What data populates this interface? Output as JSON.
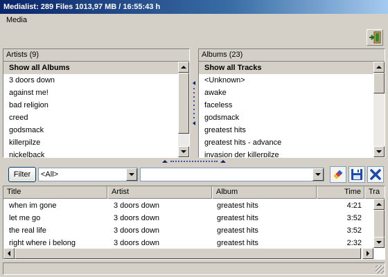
{
  "window": {
    "title": "Medialist: 289 Files 1013,97 MB / 16:55:43 h"
  },
  "menu": {
    "items": [
      "Media"
    ]
  },
  "artists": {
    "header": "Artists (9)",
    "items": [
      "Show all Albums",
      "3 doors down",
      "against me!",
      "bad religion",
      "creed",
      "godsmack",
      "killerpilze",
      "nickelback"
    ]
  },
  "albums": {
    "header": "Albums (23)",
    "items": [
      "Show all Tracks",
      "<Unknown>",
      "awake",
      "faceless",
      "godsmack",
      "greatest hits",
      "greatest hits - advance",
      "invasion der killerpilze"
    ]
  },
  "filter": {
    "button_label": "Filter",
    "field_value": "<All>",
    "search_value": ""
  },
  "tracks": {
    "columns": [
      "Title",
      "Artist",
      "Album",
      "Time",
      "Tra"
    ],
    "rows": [
      [
        "when im gone",
        "3 doors down",
        "greatest hits",
        "4:21"
      ],
      [
        "let me go",
        "3 doors down",
        "greatest hits",
        "3:52"
      ],
      [
        "the real life",
        "3 doors down",
        "greatest hits",
        "3:52"
      ],
      [
        "right where i belong",
        "3 doors down",
        "greatest hits",
        "2:32"
      ]
    ]
  },
  "status": {
    "text": ""
  },
  "icons": {
    "exit": "exit-door-icon",
    "edit": "pencil-eraser-icon",
    "save": "floppy-disk-icon",
    "delete": "blue-x-icon"
  },
  "colors": {
    "title_start": "#0a246a",
    "title_end": "#a6caf0",
    "selection": "#d4d0c8",
    "accent": "#0a46b4"
  }
}
